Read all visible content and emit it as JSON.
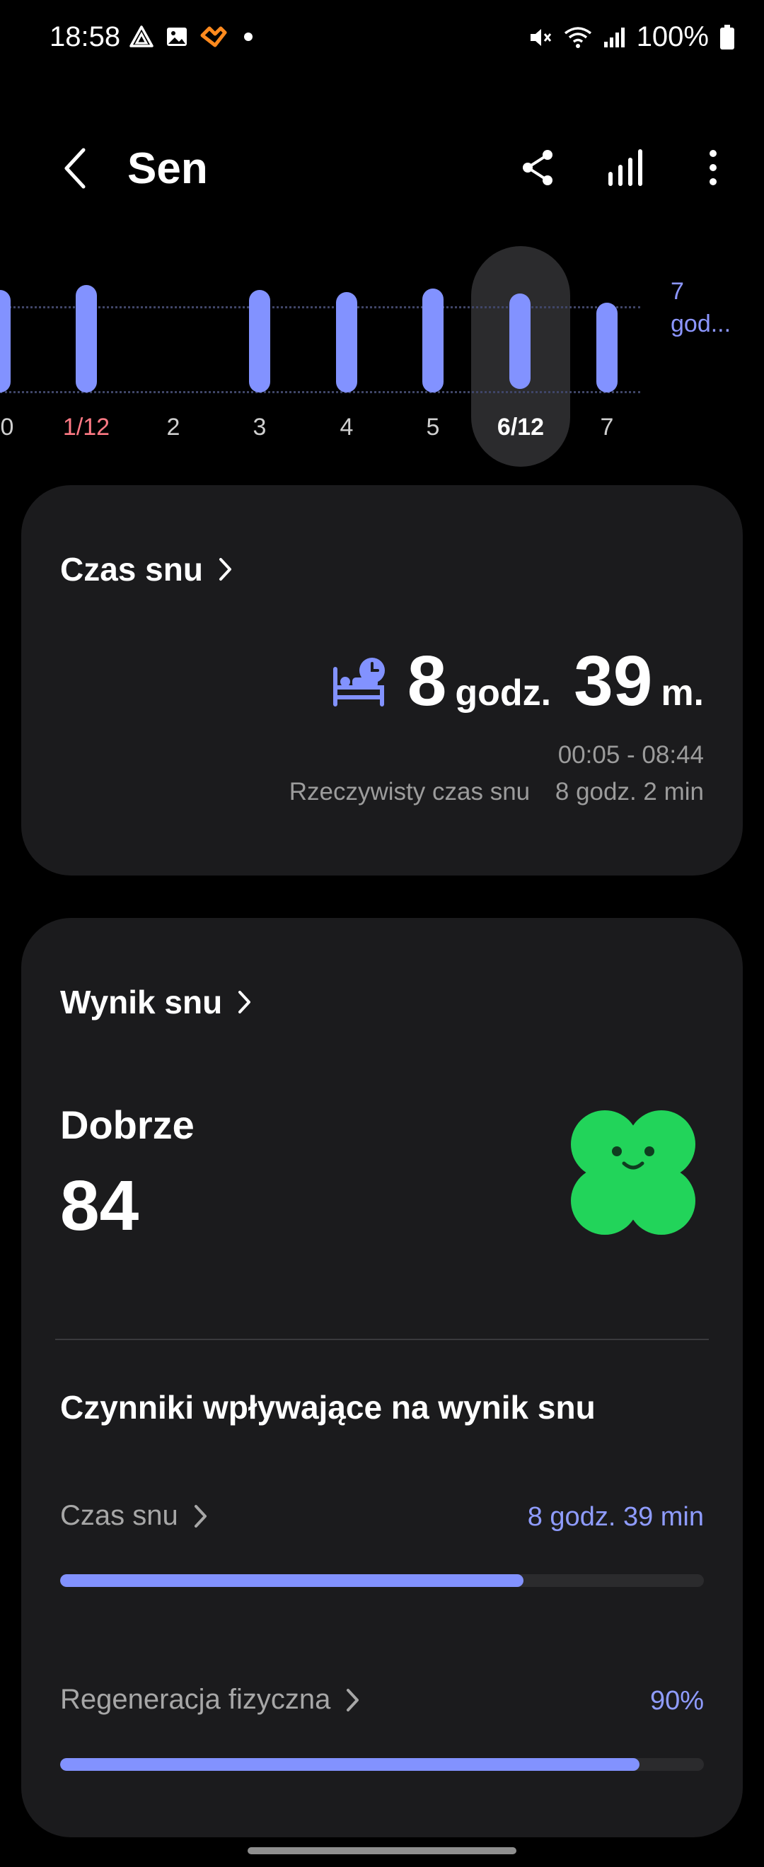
{
  "status_bar": {
    "time": "18:58",
    "battery": "100%",
    "icons": [
      "triangle-app-icon",
      "gallery-icon",
      "health-app-icon",
      "notification-dot-icon",
      "mute-icon",
      "wifi-icon",
      "signal-icon",
      "battery-icon"
    ]
  },
  "app_bar": {
    "title": "Sen",
    "actions": [
      "share-icon",
      "chart-icon",
      "more-vert-icon"
    ]
  },
  "timeline": {
    "dates": [
      "0",
      "1/12",
      "2",
      "3",
      "4",
      "5",
      "6/12",
      "7"
    ],
    "highlight_index": 1,
    "selected_index": 6,
    "goal_label_line1": "7",
    "goal_label_line2": "god...",
    "accent": "#8292ff",
    "highlight_color": "#ff7a85"
  },
  "sleep_time_card": {
    "title": "Czas snu",
    "hours": "8",
    "hours_unit": "godz.",
    "minutes": "39",
    "minutes_unit": "m.",
    "range": "00:05 - 08:44",
    "actual_label": "Rzeczywisty czas snu",
    "actual_value": "8 godz. 2 min"
  },
  "sleep_score_card": {
    "title": "Wynik snu",
    "rating": "Dobrze",
    "score": "84",
    "mascot_color": "#22d45a",
    "factors_title": "Czynniki wpływające na wynik snu",
    "factors": [
      {
        "label": "Czas snu",
        "value": "8 godz. 39 min",
        "progress": 0.72
      },
      {
        "label": "Regeneracja fizyczna",
        "value": "90%",
        "progress": 0.9
      }
    ]
  }
}
